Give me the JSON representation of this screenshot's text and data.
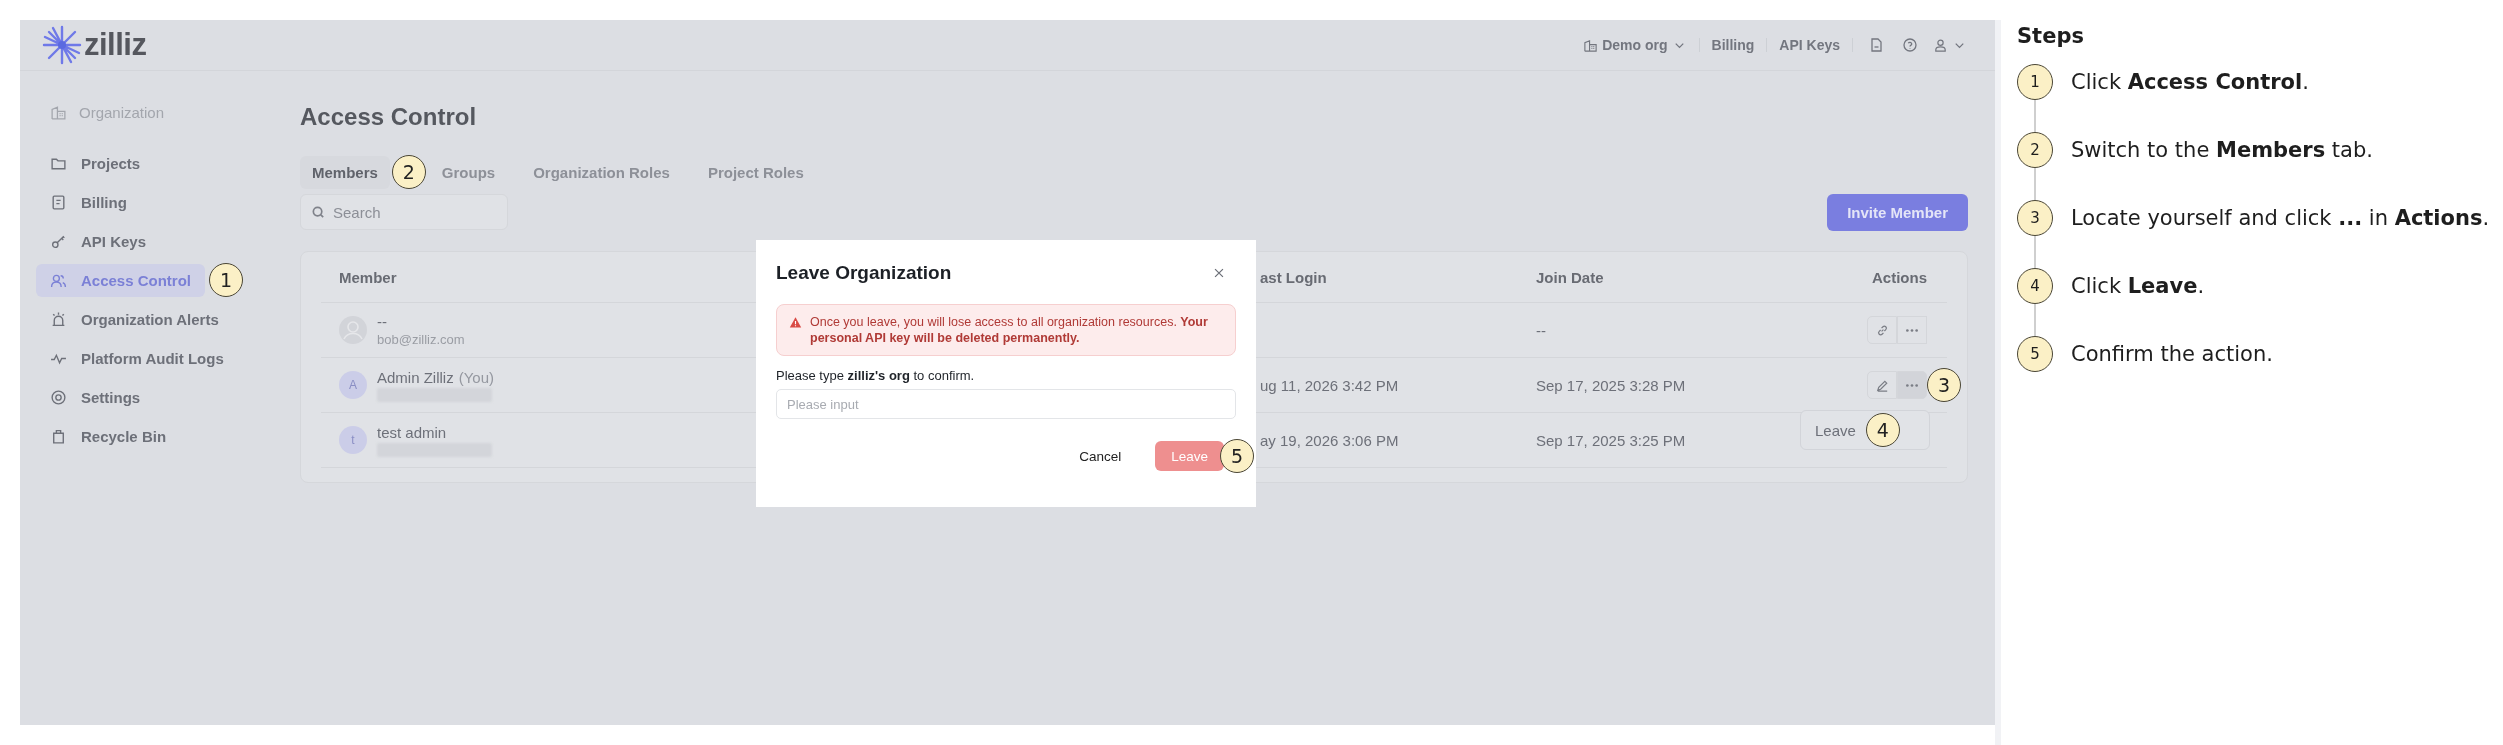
{
  "header": {
    "logo": "zilliz",
    "org": "Demo org",
    "links": [
      "Billing",
      "API Keys"
    ]
  },
  "sidebar": {
    "section": "Organization",
    "items": [
      {
        "label": "Projects",
        "selected": false
      },
      {
        "label": "Billing",
        "selected": false
      },
      {
        "label": "API Keys",
        "selected": false
      },
      {
        "label": "Access Control",
        "selected": true,
        "callout": "1"
      },
      {
        "label": "Organization Alerts",
        "selected": false
      },
      {
        "label": "Platform Audit Logs",
        "selected": false
      },
      {
        "label": "Settings",
        "selected": false
      },
      {
        "label": "Recycle Bin",
        "selected": false
      }
    ]
  },
  "page": {
    "title": "Access Control",
    "tabs": [
      {
        "label": "Members",
        "selected": true,
        "callout": "2"
      },
      {
        "label": "Groups",
        "selected": false
      },
      {
        "label": "Organization Roles",
        "selected": false
      },
      {
        "label": "Project Roles",
        "selected": false
      }
    ],
    "search": {
      "placeholder": "Search"
    },
    "invite_button": "Invite Member"
  },
  "table": {
    "columns": [
      "Member",
      "ast Login",
      "Join Date",
      "Actions"
    ],
    "rows": [
      {
        "name": "--",
        "suffix": "",
        "email": "bob@zilliz.com",
        "email_redacted": false,
        "last_login": "",
        "join_date": "--",
        "actions": [
          {
            "kind": "link",
            "active": false
          },
          {
            "kind": "more",
            "active": false
          }
        ]
      },
      {
        "initial": "A",
        "name": "Admin Zilliz",
        "suffix": "(You)",
        "email": "",
        "email_redacted": true,
        "last_login": "ug 11, 2026 3:42 PM",
        "join_date": "Sep 17, 2025 3:28 PM",
        "actions": [
          {
            "kind": "edit",
            "active": false
          },
          {
            "kind": "more",
            "active": true,
            "callout": "3"
          }
        ]
      },
      {
        "initial": "t",
        "name": "test admin",
        "suffix": "",
        "email": "",
        "email_redacted": true,
        "last_login": "ay 19, 2026 3:06 PM",
        "join_date": "Sep 17, 2025 3:25 PM",
        "actions": []
      }
    ]
  },
  "menu": {
    "items": [
      {
        "label": "Leave",
        "callout": "4"
      }
    ]
  },
  "modal": {
    "title": "Leave Organization",
    "warning": "Once you leave, you will lose access to all organization resources. **Your personal API key will be deleted permanently.**",
    "prompt": "Please type **zilliz's org** to confirm.",
    "input": {
      "placeholder": "Please input"
    },
    "cancel": "Cancel",
    "confirm": {
      "label": "Leave",
      "disabled": true,
      "callout": "5"
    }
  },
  "steps": {
    "title": "Steps",
    "items": [
      {
        "number": "1",
        "text": "Click **Access Control**."
      },
      {
        "number": "2",
        "text": "Switch to the **Members** tab."
      },
      {
        "number": "3",
        "text": "Locate yourself and click **...** in **Actions**."
      },
      {
        "number": "4",
        "text": "Click **Leave**."
      },
      {
        "number": "5",
        "text": "Confirm the action."
      }
    ]
  }
}
